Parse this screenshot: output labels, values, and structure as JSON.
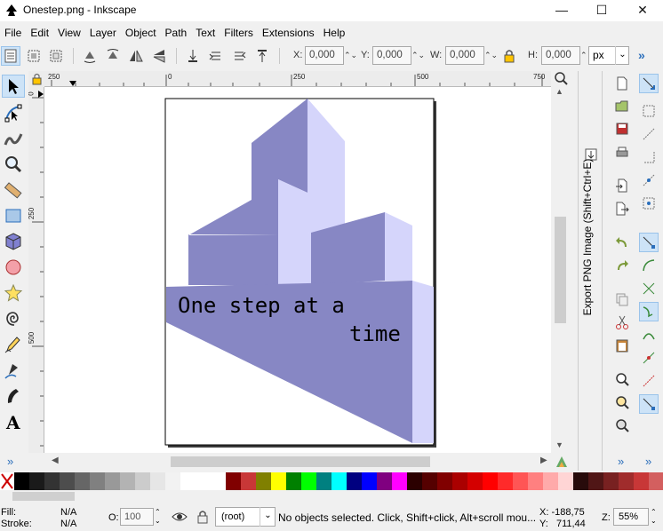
{
  "window": {
    "title": "Onestep.png - Inkscape",
    "minimize": "—",
    "maximize": "☐",
    "close": "✕"
  },
  "menu": [
    "File",
    "Edit",
    "View",
    "Layer",
    "Object",
    "Path",
    "Text",
    "Filters",
    "Extensions",
    "Help"
  ],
  "toolbar": {
    "x_label": "X:",
    "x_value": "0,000",
    "y_label": "Y:",
    "y_value": "0,000",
    "w_label": "W:",
    "w_value": "0,000",
    "h_label": "H:",
    "h_value": "0,000",
    "unit": "px"
  },
  "rulers": {
    "h_ticks": [
      "250",
      "0",
      "250",
      "500",
      "750"
    ],
    "v_ticks": [
      "0",
      "250",
      "500"
    ]
  },
  "canvas": {
    "text_line1": "One step at a",
    "text_line2": "time"
  },
  "dock": {
    "export_tab": "Export PNG Image (Shift+Ctrl+E)"
  },
  "palette": [
    "#000000",
    "#1a1a1a",
    "#333333",
    "#4d4d4d",
    "#666666",
    "#808080",
    "#999999",
    "#b3b3b3",
    "#cccccc",
    "#e6e6e6",
    "#f2f2f2",
    "#ffffff",
    "#ffffff",
    "#ffffff",
    "#800000",
    "#c83737",
    "#808000",
    "#ffff00",
    "#008000",
    "#00ff00",
    "#008080",
    "#00ffff",
    "#000080",
    "#0000ff",
    "#800080",
    "#ff00ff",
    "#2b0000",
    "#550000",
    "#800000",
    "#aa0000",
    "#d40000",
    "#ff0000",
    "#ff2a2a",
    "#ff5555",
    "#ff8080",
    "#ffaaaa",
    "#ffd5d5",
    "#280b0b",
    "#501616",
    "#782121",
    "#a02c2c",
    "#c83737",
    "#d35f5f"
  ],
  "status": {
    "fill_label": "Fill:",
    "fill_value": "N/A",
    "stroke_label": "Stroke:",
    "stroke_value": "N/A",
    "opacity_label": "O:",
    "opacity_value": "100",
    "layer": "(root)",
    "message": "No objects selected. Click, Shift+click, Alt+scroll mou...",
    "x_readout": "X: -188,75",
    "y_readout": "Y:   711,44",
    "zoom_label": "Z:",
    "zoom_value": "55%"
  },
  "colors": {
    "shape_dark": "#8787c4",
    "shape_light": "#d5d5fb"
  }
}
